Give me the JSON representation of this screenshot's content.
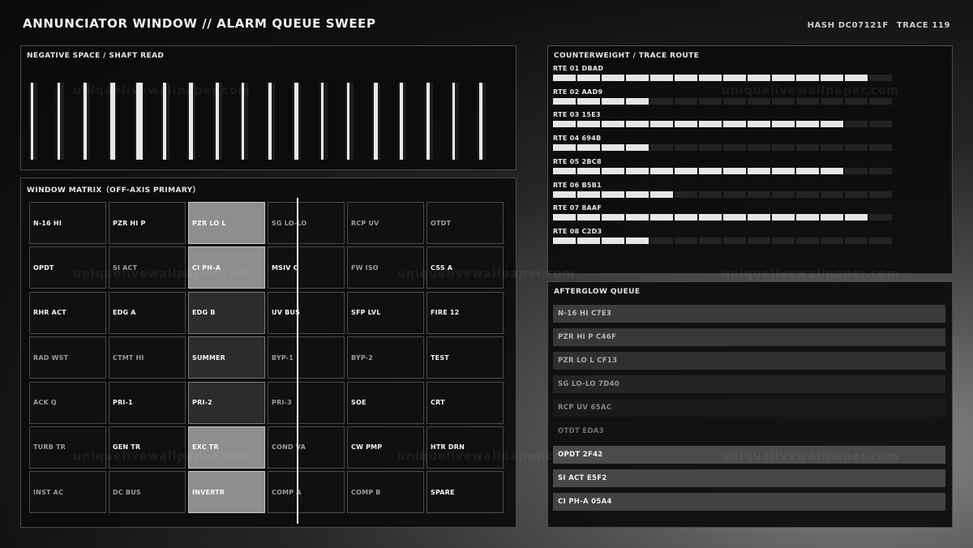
{
  "header": {
    "title": "ANNUNCIATOR WINDOW  //  ALARM QUEUE SWEEP",
    "hash": "HASH DC07121F",
    "trace": "TRACE 119"
  },
  "shaft": {
    "title": "NEGATIVE SPACE  /  SHAFT READ"
  },
  "matrix": {
    "title": "WINDOW MATRIX（OFF-AXIS PRIMARY）",
    "cells": [
      [
        "N-16 HI",
        "PZR HI P",
        "PZR LO L",
        "SG LO-LO",
        "RCP UV",
        "OTDT"
      ],
      [
        "OPDT",
        "SI ACT",
        "CI PH-A",
        "MSIV C",
        "FW ISO",
        "CSS A"
      ],
      [
        "RHR ACT",
        "EDG A",
        "EDG B",
        "UV BUS",
        "SFP LVL",
        "FIRE 12"
      ],
      [
        "RAD WST",
        "CTMT HI",
        "SUMMER",
        "BYP-1",
        "BYP-2",
        "TEST"
      ],
      [
        "ACK Q",
        "PRI-1",
        "PRI-2",
        "PRI-3",
        "SOE",
        "CRT"
      ],
      [
        "TURB TR",
        "GEN TR",
        "EXC TR",
        "COND VA",
        "CW PMP",
        "HTR DRN"
      ],
      [
        "INST AC",
        "DC BUS",
        "INVERTR",
        "COMP A",
        "COMP B",
        "SPARE"
      ]
    ]
  },
  "routes": {
    "title": "COUNTERWEIGHT  /  TRACE ROUTE",
    "items": [
      {
        "label": "RTE 01  DBAD",
        "fill": 13
      },
      {
        "label": "RTE 02  AAD9",
        "fill": 4
      },
      {
        "label": "RTE 03  15E3",
        "fill": 12
      },
      {
        "label": "RTE 04  694B",
        "fill": 4
      },
      {
        "label": "RTE 05  2BC8",
        "fill": 12
      },
      {
        "label": "RTE 06  B5B1",
        "fill": 5
      },
      {
        "label": "RTE 07  8AAF",
        "fill": 13
      },
      {
        "label": "RTE 08  C2D3",
        "fill": 4
      }
    ]
  },
  "afterglow": {
    "title": "AFTERGLOW QUEUE",
    "items": [
      {
        "label": "N-16 HI   C7E3"
      },
      {
        "label": "PZR HI P   C46F"
      },
      {
        "label": "PZR LO L   CF13"
      },
      {
        "label": "SG LO-LO   7D40"
      },
      {
        "label": "RCP UV   65AC"
      },
      {
        "label": "OTDT   EDA3"
      },
      {
        "label": "OPDT   2F42"
      },
      {
        "label": "SI ACT   E5F2"
      },
      {
        "label": "CI PH-A   05A4"
      }
    ]
  },
  "watermark": "uniquelivewallpaper.com"
}
